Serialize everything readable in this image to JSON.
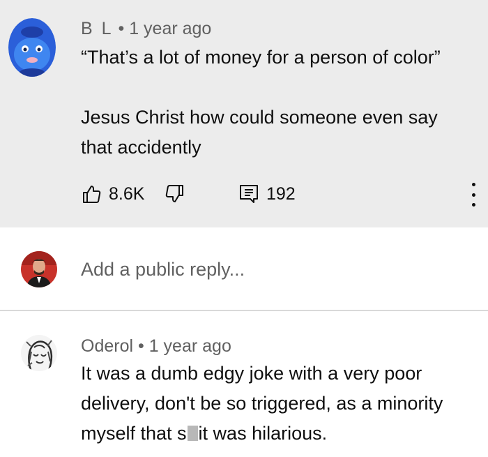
{
  "comment": {
    "author": "B L",
    "time": "1 year ago",
    "line1": "“That’s a lot of money for a person of color”",
    "line2": "Jesus Christ how could someone even say",
    "line3": "that accidently",
    "likes": "8.6K",
    "replies": "192",
    "avatar_icon": "fish-character-avatar"
  },
  "reply_box": {
    "placeholder": "Add a public reply...",
    "avatar_icon": "user-portrait-avatar"
  },
  "reply": {
    "author": "Oderol",
    "time": "1 year ago",
    "line1": "It was a dumb edgy joke with a very poor",
    "line2": "delivery, don't be so triggered, as a minority",
    "line3_before": "myself that s",
    "line3_after": "it was hilarious.",
    "avatar_icon": "sketch-portrait-avatar"
  },
  "colors": {
    "comment_bg": "#ececec",
    "text": "#0f0f0f",
    "secondary_text": "#606060"
  }
}
